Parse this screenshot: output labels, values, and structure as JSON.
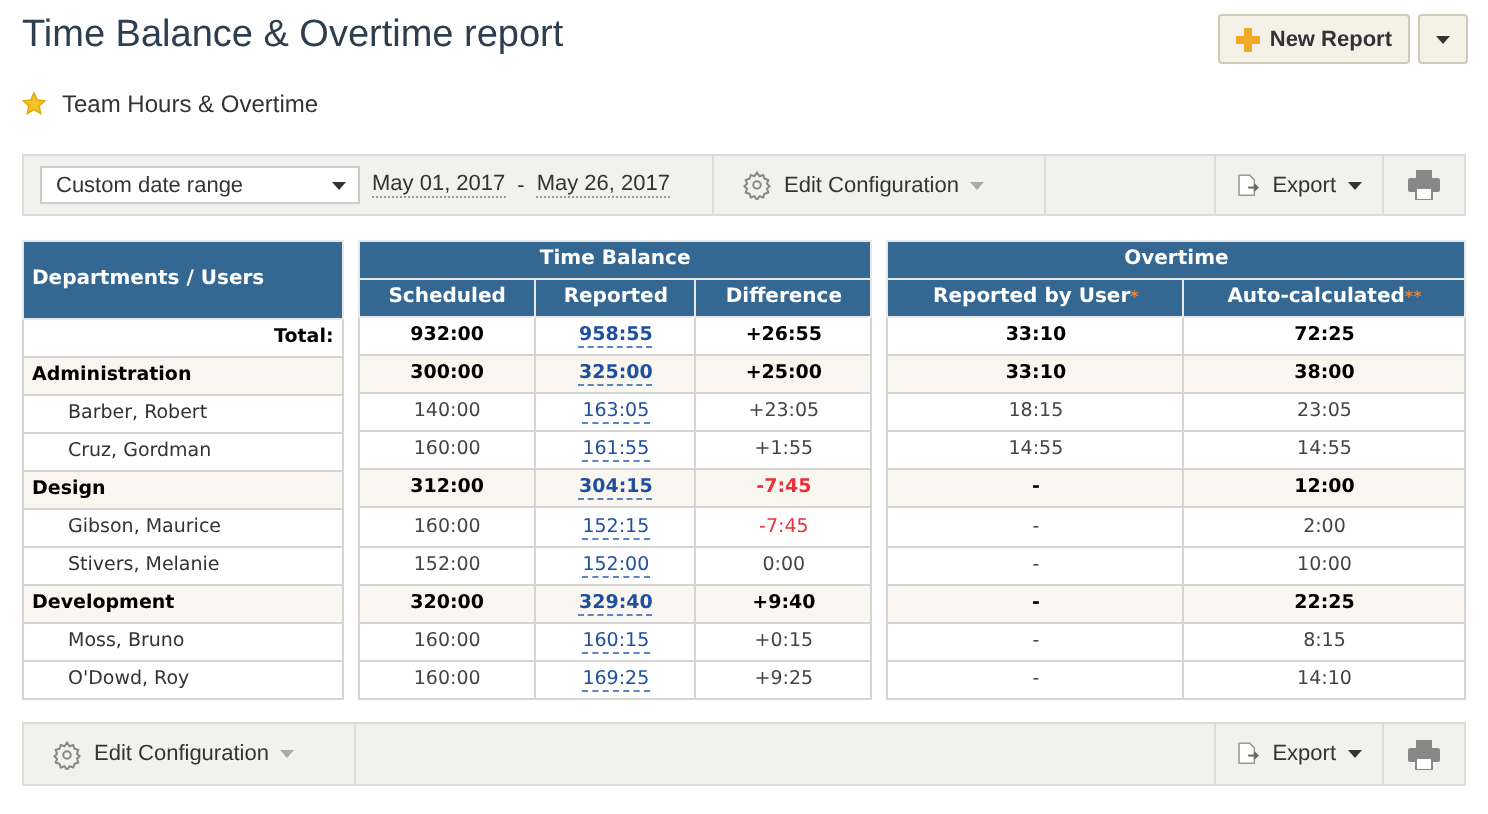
{
  "title": "Time Balance & Overtime report",
  "new_report": {
    "label": "New Report"
  },
  "favorite": {
    "label": "Team Hours & Overtime",
    "starred": true
  },
  "toolbar": {
    "range": "Custom date range",
    "date_from": "May 01, 2017",
    "date_sep": "-",
    "date_to": "May 26, 2017",
    "config": "Edit Configuration",
    "export": "Export"
  },
  "table": {
    "name_header": "Departments / Users",
    "groups": [
      {
        "label": "Time Balance",
        "columns": [
          {
            "label": "Scheduled"
          },
          {
            "label": "Reported"
          },
          {
            "label": "Difference"
          }
        ]
      },
      {
        "label": "Overtime",
        "columns": [
          {
            "label": "Reported by User",
            "note": "*"
          },
          {
            "label": "Auto-calculated",
            "note": "**"
          }
        ]
      }
    ],
    "rows": [
      {
        "kind": "total",
        "name": "Total:",
        "cells": [
          "932:00",
          "958:55",
          "+26:55",
          "33:10",
          "72:25"
        ],
        "negative": false
      },
      {
        "kind": "dept",
        "name": "Administration",
        "cells": [
          "300:00",
          "325:00",
          "+25:00",
          "33:10",
          "38:00"
        ],
        "negative": false
      },
      {
        "kind": "user",
        "name": "Barber, Robert",
        "cells": [
          "140:00",
          "163:05",
          "+23:05",
          "18:15",
          "23:05"
        ],
        "negative": false
      },
      {
        "kind": "user",
        "name": "Cruz, Gordman",
        "cells": [
          "160:00",
          "161:55",
          "+1:55",
          "14:55",
          "14:55"
        ],
        "negative": false
      },
      {
        "kind": "dept",
        "name": "Design",
        "cells": [
          "312:00",
          "304:15",
          "-7:45",
          "-",
          "12:00"
        ],
        "negative": true
      },
      {
        "kind": "user",
        "name": "Gibson, Maurice",
        "cells": [
          "160:00",
          "152:15",
          "-7:45",
          "-",
          "2:00"
        ],
        "negative": true
      },
      {
        "kind": "user",
        "name": "Stivers, Melanie",
        "cells": [
          "152:00",
          "152:00",
          "0:00",
          "-",
          "10:00"
        ],
        "negative": false
      },
      {
        "kind": "dept",
        "name": "Development",
        "cells": [
          "320:00",
          "329:40",
          "+9:40",
          "-",
          "22:25"
        ],
        "negative": false
      },
      {
        "kind": "user",
        "name": "Moss, Bruno",
        "cells": [
          "160:00",
          "160:15",
          "+0:15",
          "-",
          "8:15"
        ],
        "negative": false
      },
      {
        "kind": "user",
        "name": "O'Dowd, Roy",
        "cells": [
          "160:00",
          "169:25",
          "+9:25",
          "-",
          "14:10"
        ],
        "negative": false
      }
    ]
  },
  "footer": {
    "config": "Edit Configuration",
    "export": "Export"
  }
}
